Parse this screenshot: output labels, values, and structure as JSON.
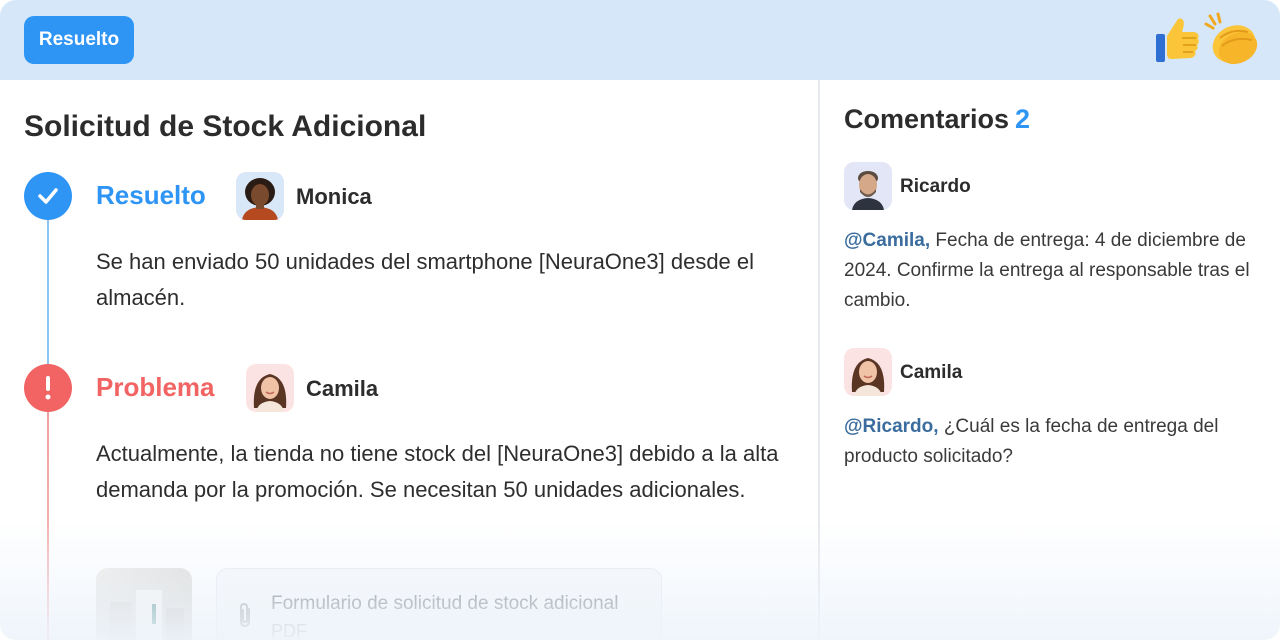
{
  "header": {
    "status_label": "Resuelto",
    "reactions": [
      "thumbs-up-icon",
      "clapping-hands-icon"
    ]
  },
  "request": {
    "title": "Solicitud de Stock Adicional",
    "steps": [
      {
        "status": "Resuelto",
        "status_color": "#2f95f5",
        "icon": "check-icon",
        "author": "Monica",
        "text": "Se han enviado 50 unidades del smartphone [NeuraOne3] desde el almacén."
      },
      {
        "status": "Problema",
        "status_color": "#f26464",
        "icon": "exclamation-icon",
        "author": "Camila",
        "text": "Actualmente, la tienda no tiene stock del [NeuraOne3] debido a la alta demanda por la promoción. Se necesitan 50 unidades adicionales.",
        "attachment": {
          "name": "Formulario de solicitud de stock adicional",
          "type": "PDF"
        }
      }
    ]
  },
  "comments": {
    "title": "Comentarios",
    "count": "2",
    "items": [
      {
        "author": "Ricardo",
        "mention": "@Camila,",
        "text": " Fecha de entrega: 4 de diciembre de 2024. Confirme la entrega al responsable tras el cambio."
      },
      {
        "author": "Camila",
        "mention": "@Ricardo,",
        "text": " ¿Cuál es la fecha de entrega del producto solicitado?"
      }
    ]
  },
  "colors": {
    "accent": "#2f95f5",
    "problem": "#f26464",
    "header_bg": "#d5e7f9",
    "mention": "#3a6c9e"
  }
}
